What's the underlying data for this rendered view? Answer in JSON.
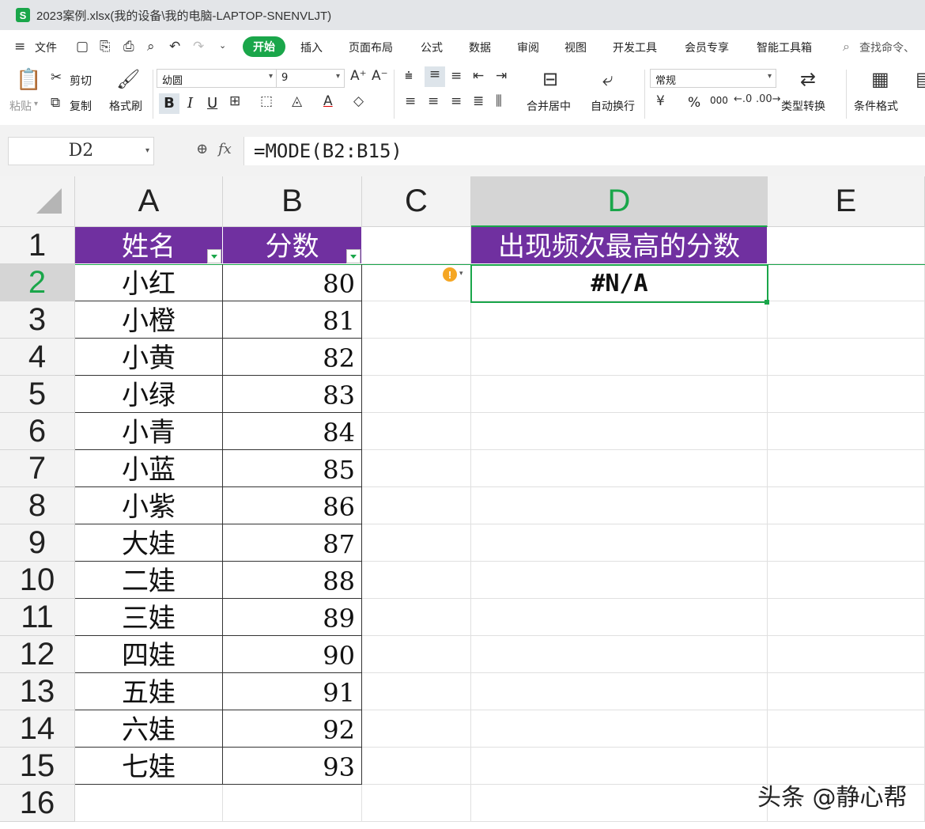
{
  "window": {
    "title": "2023案例.xlsx(我的设备\\我的电脑-LAPTOP-SNENVLJT)",
    "logo": "S"
  },
  "menu": {
    "file": "文件",
    "tabs": [
      "开始",
      "插入",
      "页面布局",
      "公式",
      "数据",
      "审阅",
      "视图",
      "开发工具",
      "会员专享",
      "智能工具箱"
    ],
    "search": "查找命令、"
  },
  "ribbon": {
    "paste": "粘贴",
    "cut": "剪切",
    "copy": "复制",
    "format_painter": "格式刷",
    "font_name": "幼圆",
    "font_size": "9",
    "bold": "B",
    "italic": "I",
    "underline": "U",
    "merge_center": "合并居中",
    "wrap_text": "自动换行",
    "number_format": "常规",
    "percent": "%",
    "thousands": "000",
    "convert_type": "类型转换",
    "conditional_format": "条件格式"
  },
  "formula_bar": {
    "name_box": "D2",
    "fx": "fx",
    "formula": "=MODE(B2:B15)"
  },
  "sheet": {
    "columns": [
      "A",
      "B",
      "C",
      "D",
      "E"
    ],
    "selected_column": "D",
    "rows": [
      "1",
      "2",
      "3",
      "4",
      "5",
      "6",
      "7",
      "8",
      "9",
      "10",
      "11",
      "12",
      "13",
      "14",
      "15",
      "16"
    ],
    "selected_row": "2",
    "header_name": "姓名",
    "header_score": "分数",
    "header_d": "出现频次最高的分数",
    "names": [
      "小红",
      "小橙",
      "小黄",
      "小绿",
      "小青",
      "小蓝",
      "小紫",
      "大娃",
      "二娃",
      "三娃",
      "四娃",
      "五娃",
      "六娃",
      "七娃"
    ],
    "scores": [
      "80",
      "81",
      "82",
      "83",
      "84",
      "85",
      "86",
      "87",
      "88",
      "89",
      "90",
      "91",
      "92",
      "93"
    ],
    "d2_value": "#N/A",
    "header_fill": "#7030a0",
    "accent": "#1aa64a"
  },
  "watermark": "头条 @静心帮"
}
